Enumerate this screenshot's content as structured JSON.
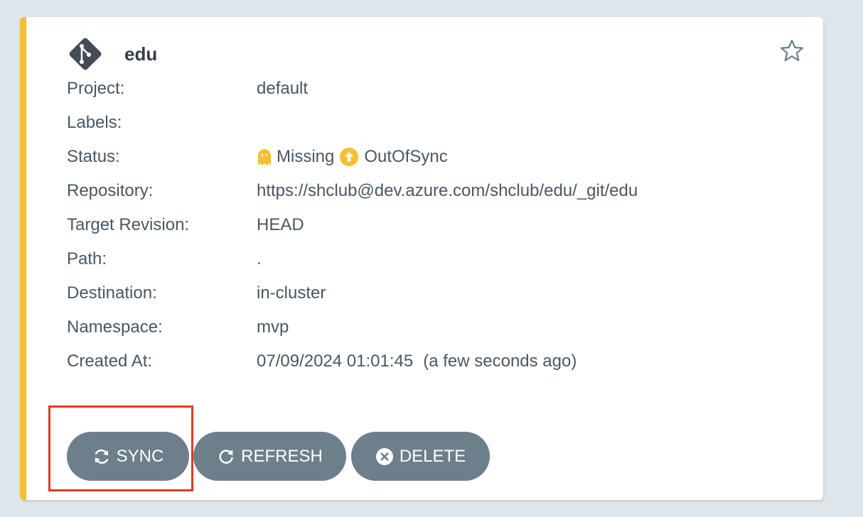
{
  "app": {
    "name": "edu",
    "icon": "git-icon",
    "favorite_icon": "star-icon"
  },
  "fields": {
    "project": {
      "label": "Project:",
      "value": "default"
    },
    "labels": {
      "label": "Labels:",
      "value": ""
    },
    "status": {
      "label": "Status:",
      "health": "Missing",
      "health_icon": "ghost-icon",
      "sync": "OutOfSync",
      "sync_icon": "arrow-up-circle-icon"
    },
    "repository": {
      "label": "Repository:",
      "value": "https://shclub@dev.azure.com/shclub/edu/_git/edu"
    },
    "target_revision": {
      "label": "Target Revision:",
      "value": "HEAD"
    },
    "path": {
      "label": "Path:",
      "value": "."
    },
    "destination": {
      "label": "Destination:",
      "value": "in-cluster"
    },
    "namespace": {
      "label": "Namespace:",
      "value": "mvp"
    },
    "created_at": {
      "label": "Created At:",
      "value": "07/09/2024 01:01:45",
      "relative": "(a few seconds ago)"
    }
  },
  "actions": {
    "sync_label": "SYNC",
    "refresh_label": "REFRESH",
    "delete_label": "DELETE"
  },
  "colors": {
    "accent": "#f4c030",
    "button": "#6d7f8b",
    "highlight": "#e03a26",
    "background": "#dee6eb"
  }
}
